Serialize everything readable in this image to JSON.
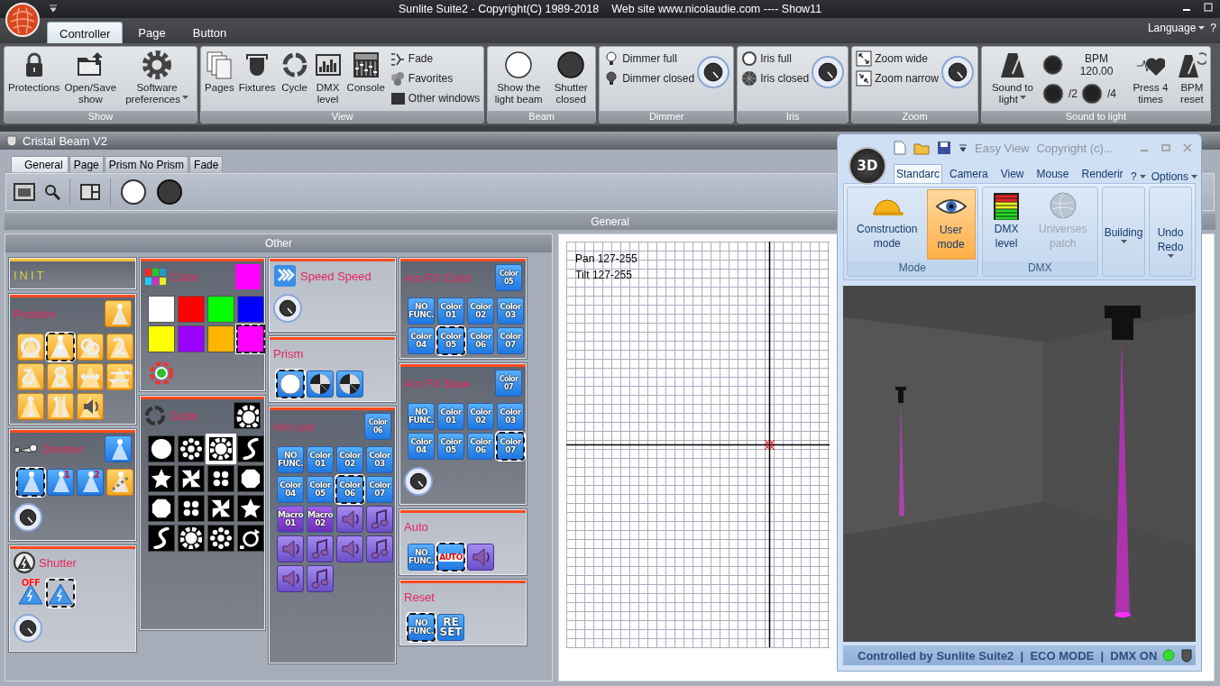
{
  "window": {
    "title": "Sunlite Suite2 - Copyright(C) 1989-2018    Web site www.nicolaudie.com ---- Show11"
  },
  "ribbon_tabs": [
    {
      "label": "Controller",
      "selected": true
    },
    {
      "label": "Page",
      "selected": false
    },
    {
      "label": "Button",
      "selected": false
    }
  ],
  "language_menu": "Language",
  "help": "?",
  "ribbon_groups": [
    {
      "title": "Show",
      "items": [
        {
          "kind": "lock",
          "label": "Protections"
        },
        {
          "kind": "folder",
          "label": "Open/Save show"
        },
        {
          "kind": "gear",
          "label": "Software preferences",
          "dropdown": true
        }
      ]
    },
    {
      "title": "View",
      "items": [
        {
          "kind": "pages",
          "label": "Pages"
        },
        {
          "kind": "fixture",
          "label": "Fixtures"
        },
        {
          "kind": "cycle",
          "label": "Cycle"
        },
        {
          "kind": "dmx",
          "label": "DMX level"
        },
        {
          "kind": "console",
          "label": "Console"
        },
        {
          "kind": "list",
          "entries": [
            {
              "kind": "fade",
              "label": "Fade"
            },
            {
              "kind": "favorites",
              "label": "Favorites"
            },
            {
              "kind": "windows",
              "label": "Other windows"
            }
          ]
        }
      ]
    },
    {
      "title": "Beam",
      "items": [
        {
          "kind": "white-disc",
          "label": "Show the light beam"
        },
        {
          "kind": "dark-disc",
          "label": "Shutter closed"
        }
      ]
    },
    {
      "title": "Dimmer",
      "items": [
        {
          "kind": "list",
          "entries": [
            {
              "kind": "bulb-on",
              "label": "Dimmer full"
            },
            {
              "kind": "bulb-off",
              "label": "Dimmer closed"
            }
          ]
        },
        {
          "kind": "knob"
        }
      ]
    },
    {
      "title": "Iris",
      "items": [
        {
          "kind": "list",
          "entries": [
            {
              "kind": "iris-open",
              "label": "Iris full"
            },
            {
              "kind": "iris-closed",
              "label": "Iris closed"
            }
          ]
        },
        {
          "kind": "knob"
        }
      ]
    },
    {
      "title": "Zoom",
      "items": [
        {
          "kind": "list",
          "entries": [
            {
              "kind": "zoom-wide",
              "label": "Zoom wide"
            },
            {
              "kind": "zoom-narrow",
              "label": "Zoom narrow"
            }
          ]
        },
        {
          "kind": "knob"
        }
      ]
    },
    {
      "title": "Sound to light",
      "items": [
        {
          "kind": "metronome",
          "label": "Sound to light",
          "dropdown": true
        },
        {
          "kind": "bpm",
          "entries": [
            {
              "kind": "led",
              "label": "BPM 120.00"
            },
            {
              "kind": "led",
              "label": "/2"
            },
            {
              "kind": "led",
              "label": "/4"
            }
          ]
        },
        {
          "kind": "heart",
          "label": "Press 4 times"
        },
        {
          "kind": "metronome-reset",
          "label": "BPM reset"
        }
      ]
    }
  ],
  "fixture_window": {
    "title": "Cristal Beam V2",
    "tabs": [
      {
        "label": "General",
        "selected": true
      },
      {
        "label": "Page",
        "selected": false
      },
      {
        "label": "Prism No Prism",
        "selected": false
      },
      {
        "label": "Fade",
        "selected": false
      }
    ],
    "section": "General",
    "group": "Other",
    "columns": [
      [
        {
          "kind": "init",
          "title": "INIT",
          "active": true
        },
        {
          "kind": "position",
          "title": "Position",
          "active": true,
          "corner": {
            "kind": "position-beam"
          },
          "buttons": [
            {
              "kind": "circle",
              "selected": false
            },
            {
              "kind": "cross",
              "selected": true
            },
            {
              "kind": "rings",
              "selected": false
            },
            {
              "kind": "s-curve",
              "selected": false
            },
            {
              "kind": "zigzag",
              "selected": false
            },
            {
              "kind": "eight",
              "selected": false
            },
            {
              "kind": "arrow-h",
              "selected": false
            },
            {
              "kind": "arrows-h",
              "selected": false
            },
            {
              "kind": "arrow-v",
              "selected": false
            },
            {
              "kind": "arrows-v",
              "selected": false
            },
            {
              "kind": "speaker-orange",
              "selected": false
            }
          ]
        },
        {
          "kind": "dimmer",
          "title": "Dimmer",
          "active": true,
          "corner": {
            "kind": "beam"
          },
          "knob": true,
          "buttons": [
            {
              "kind": "beam",
              "selected": true
            },
            {
              "kind": "beam",
              "label": "1",
              "selected": false
            },
            {
              "kind": "beam",
              "label": "2",
              "selected": false
            },
            {
              "kind": "strobe",
              "selected": false
            }
          ]
        },
        {
          "kind": "shutter",
          "title": "Shutter",
          "active": false,
          "knob": true,
          "buttons": [
            {
              "kind": "shutter",
              "label": "OFF",
              "selected": false
            },
            {
              "kind": "shutter",
              "selected": true
            }
          ]
        }
      ],
      [
        {
          "kind": "color",
          "title": "Color",
          "active": true,
          "corner": {
            "kind": "swatch",
            "color": "#ff00ff"
          },
          "swatches": [
            {
              "color": "#ffffff",
              "selected": false
            },
            {
              "color": "#ff0000",
              "selected": false
            },
            {
              "color": "#00ff00",
              "selected": false
            },
            {
              "color": "#0000ff",
              "selected": false
            },
            {
              "color": "#ffff00",
              "selected": false
            },
            {
              "color": "#9900ff",
              "selected": false
            },
            {
              "color": "#ffb400",
              "selected": false
            },
            {
              "color": "#ff00ff",
              "selected": true
            }
          ],
          "buttons": [
            {
              "kind": "wheel",
              "selected": false
            }
          ]
        },
        {
          "kind": "gobo",
          "title": "Gobo",
          "active": true,
          "corner": {
            "kind": "gobo-flower"
          },
          "buttons": [
            {
              "kind": "gobo-disc",
              "selected": false
            },
            {
              "kind": "gobo-dots",
              "selected": false
            },
            {
              "kind": "gobo-flower",
              "selected": true
            },
            {
              "kind": "gobo-wave",
              "selected": false
            },
            {
              "kind": "gobo-star",
              "selected": false
            },
            {
              "kind": "gobo-fan",
              "selected": false
            },
            {
              "kind": "gobo-quad",
              "selected": false
            },
            {
              "kind": "gobo-octagon",
              "selected": false
            },
            {
              "kind": "gobo-octagon",
              "selected": false
            },
            {
              "kind": "gobo-quad",
              "selected": false
            },
            {
              "kind": "gobo-fan",
              "selected": false
            },
            {
              "kind": "gobo-star",
              "selected": false
            },
            {
              "kind": "gobo-wave",
              "selected": false
            },
            {
              "kind": "gobo-flower",
              "selected": false
            },
            {
              "kind": "gobo-dots",
              "selected": false
            },
            {
              "kind": "rotate",
              "selected": false
            }
          ]
        }
      ],
      [
        {
          "kind": "speed",
          "title": "Speed Speed",
          "active": false,
          "knob": true
        },
        {
          "kind": "prism",
          "title": "Prism",
          "active": false,
          "buttons": [
            {
              "kind": "ball",
              "selected": true
            },
            {
              "kind": "prism",
              "selected": false
            },
            {
              "kind": "prism",
              "selected": false
            }
          ]
        },
        {
          "kind": "fx",
          "title": "Aro Led",
          "active": true,
          "corner": {
            "kind": "color",
            "label": "Color 06"
          },
          "buttons": [
            {
              "kind": "nofunc",
              "label": "NO FUNC.",
              "selected": false
            },
            {
              "kind": "color",
              "label": "Color 01",
              "selected": false
            },
            {
              "kind": "color",
              "label": "Color 02",
              "selected": false
            },
            {
              "kind": "color",
              "label": "Color 03",
              "selected": false
            },
            {
              "kind": "color",
              "label": "Color 04",
              "selected": false
            },
            {
              "kind": "color",
              "label": "Color 05",
              "selected": false
            },
            {
              "kind": "color",
              "label": "Color 06",
              "selected": true
            },
            {
              "kind": "color",
              "label": "Color 07",
              "selected": false
            },
            {
              "kind": "macro",
              "label": "Macro 01",
              "selected": false
            },
            {
              "kind": "macro",
              "label": "Macro 02",
              "selected": false
            },
            {
              "kind": "sound",
              "selected": false
            },
            {
              "kind": "note",
              "selected": false
            },
            {
              "kind": "sound",
              "selected": false
            },
            {
              "kind": "note",
              "selected": false
            },
            {
              "kind": "sound",
              "selected": false
            },
            {
              "kind": "note",
              "selected": false
            },
            {
              "kind": "sound",
              "selected": false
            },
            {
              "kind": "note",
              "selected": false
            }
          ]
        }
      ],
      [
        {
          "kind": "fx",
          "title": "Aro FX Color",
          "active": true,
          "corner": {
            "kind": "color",
            "label": "Color 05"
          },
          "buttons": [
            {
              "kind": "nofunc",
              "label": "NO FUNC.",
              "selected": false
            },
            {
              "kind": "color",
              "label": "Color 01",
              "selected": false
            },
            {
              "kind": "color",
              "label": "Color 02",
              "selected": false
            },
            {
              "kind": "color",
              "label": "Color 03",
              "selected": false
            },
            {
              "kind": "color",
              "label": "Color 04",
              "selected": false
            },
            {
              "kind": "color",
              "label": "Color 05",
              "selected": true
            },
            {
              "kind": "color",
              "label": "Color 06",
              "selected": false
            },
            {
              "kind": "color",
              "label": "Color 07",
              "selected": false
            }
          ]
        },
        {
          "kind": "fx",
          "title": "Aro FX Base",
          "active": true,
          "knob": true,
          "corner": {
            "kind": "color",
            "label": "Color 07"
          },
          "buttons": [
            {
              "kind": "nofunc",
              "label": "NO FUNC.",
              "selected": false
            },
            {
              "kind": "color",
              "label": "Color 01",
              "selected": false
            },
            {
              "kind": "color",
              "label": "Color 02",
              "selected": false
            },
            {
              "kind": "color",
              "label": "Color 03",
              "selected": false
            },
            {
              "kind": "color",
              "label": "Color 04",
              "selected": false
            },
            {
              "kind": "color",
              "label": "Color 05",
              "selected": false
            },
            {
              "kind": "color",
              "label": "Color 06",
              "selected": false
            },
            {
              "kind": "color",
              "label": "Color 07",
              "selected": true
            }
          ]
        },
        {
          "kind": "fx",
          "title": "Auto",
          "active": false,
          "buttons": [
            {
              "kind": "nofunc",
              "label": "NO FUNC.",
              "selected": false
            },
            {
              "kind": "auto",
              "label": "AUTO",
              "selected": true
            },
            {
              "kind": "sound",
              "selected": false
            }
          ]
        },
        {
          "kind": "fx",
          "title": "Reset",
          "active": false,
          "buttons": [
            {
              "kind": "nofunc",
              "label": "NO FUNC.",
              "selected": true
            },
            {
              "kind": "reset",
              "label": "RE SET",
              "selected": false
            }
          ]
        }
      ]
    ],
    "readouts": [
      "Pan 127-255",
      "Tilt 127-255"
    ]
  },
  "easy_view": {
    "orb_label": "3D",
    "title": "Easy View",
    "copyright": "Copyright (c)...",
    "tabs": [
      {
        "label": "Standarc",
        "selected": true
      },
      {
        "label": "Camera",
        "selected": false
      },
      {
        "label": "View",
        "selected": false
      },
      {
        "label": "Mouse",
        "selected": false
      },
      {
        "label": "Renderir",
        "selected": false
      }
    ],
    "help": "?",
    "options": "Options",
    "groups": [
      {
        "title": "Mode",
        "items": [
          {
            "kind": "helmet",
            "label": "Construction mode",
            "selected": false
          },
          {
            "kind": "eye",
            "label": "User mode",
            "selected": true
          }
        ]
      },
      {
        "title": "DMX",
        "items": [
          {
            "kind": "meter",
            "label": "DMX level",
            "disabled": false
          },
          {
            "kind": "globe",
            "label": "Universes patch",
            "disabled": true
          }
        ]
      },
      {
        "items": [
          {
            "kind": "menu",
            "label": "Building"
          }
        ]
      },
      {
        "items": [
          {
            "kind": "menu",
            "label": "Undo Redo"
          }
        ]
      }
    ],
    "status": "Controlled by Sunlite Suite2  |  ECO MODE  |  DMX ON"
  }
}
